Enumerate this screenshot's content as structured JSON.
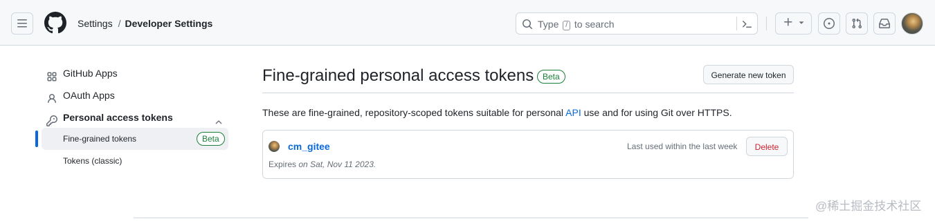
{
  "header": {
    "breadcrumb": {
      "first": "Settings",
      "separator": "/",
      "current": "Developer Settings"
    },
    "search": {
      "prefix": "Type",
      "key": "/",
      "suffix": "to search"
    },
    "icons": {
      "menu": "hamburger-icon",
      "logo": "github-logo",
      "search": "search-icon",
      "command": "command-palette-icon",
      "plus": "plus-icon",
      "caret": "caret-down-icon",
      "issues": "issue-opened-icon",
      "pulls": "git-pull-request-icon",
      "inbox": "inbox-icon"
    }
  },
  "sidebar": {
    "items": [
      {
        "label": "GitHub Apps",
        "icon": "apps-icon"
      },
      {
        "label": "OAuth Apps",
        "icon": "person-icon"
      },
      {
        "label": "Personal access tokens",
        "icon": "key-icon",
        "expanded": true
      }
    ],
    "sub_items": [
      {
        "label": "Fine-grained tokens",
        "badge": "Beta",
        "active": true
      },
      {
        "label": "Tokens (classic)"
      }
    ]
  },
  "main": {
    "title": "Fine-grained personal access tokens",
    "title_badge": "Beta",
    "generate_button": "Generate new token",
    "description": {
      "before": "These are fine-grained, repository-scoped tokens suitable for personal ",
      "link": "API",
      "after": " use and for using Git over HTTPS."
    },
    "tokens": [
      {
        "name": "cm_gitee",
        "last_used": "Last used within the last week",
        "delete_label": "Delete",
        "expires_prefix": "Expires",
        "expires_date": "on Sat, Nov 11 2023."
      }
    ]
  },
  "watermark": "@稀土掘金技术社区",
  "colors": {
    "accent": "#0969da",
    "success": "#1a7f37",
    "danger": "#cf222e",
    "border": "#d0d7de",
    "header_bg": "#f6f8fa"
  }
}
